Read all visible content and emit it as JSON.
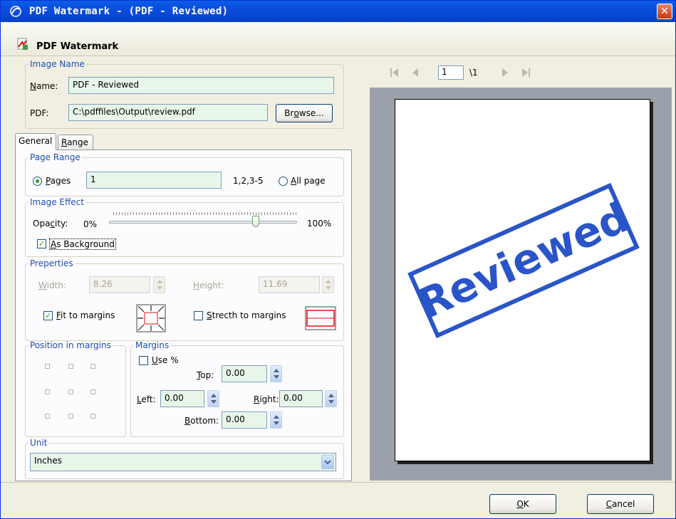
{
  "window": {
    "title": "PDF Watermark - (PDF - Reviewed)",
    "close_glyph": "✕"
  },
  "header": {
    "title": "PDF Watermark"
  },
  "image_name": {
    "legend": "Image Name",
    "name_label_u": "N",
    "name_label_rest": "ame:",
    "name_value": "PDF - Reviewed",
    "pdf_label": "PDF:",
    "pdf_value": "C:\\pdffiles\\Output\\review.pdf",
    "browse_pre": "Br",
    "browse_u": "o",
    "browse_post": "wse..."
  },
  "tabs": {
    "general": "General",
    "range_u": "R",
    "range_rest": "ange"
  },
  "page_range": {
    "legend": "Page Range",
    "pages_u": "P",
    "pages_rest": "ages",
    "pages_value": "1",
    "hint": "1,2,3-5",
    "all_u": "A",
    "all_rest": "ll page",
    "selected": "pages"
  },
  "image_effect": {
    "legend": "Image Effect",
    "opacity_pre": "Opa",
    "opacity_u": "c",
    "opacity_post": "ity:",
    "min_label": "0%",
    "max_label": "100%",
    "opacity_fraction": 0.78,
    "as_background_u": "A",
    "as_background_rest": "s Background",
    "as_background_checked": true
  },
  "properties": {
    "legend": "Preperties",
    "width_u": "W",
    "width_rest": "idth:",
    "width_value": "8.26",
    "height_u": "H",
    "height_rest": "eight:",
    "height_value": "11.69",
    "fit_u": "F",
    "fit_rest": "it to margins",
    "fit_checked": true,
    "stretch_u": "S",
    "stretch_rest": "trecth to margins",
    "stretch_checked": false
  },
  "position": {
    "legend": "Position in margins"
  },
  "margins": {
    "legend": "Margins",
    "use_pct_u": "U",
    "use_pct_rest": "se %",
    "top_u": "T",
    "top_rest": "op:",
    "top_value": "0.00",
    "left_u": "L",
    "left_rest": "eft:",
    "left_value": "0.00",
    "right_u": "R",
    "right_rest": "ight:",
    "right_value": "0.00",
    "bottom_u": "B",
    "bottom_rest": "ottom:",
    "bottom_value": "0.00"
  },
  "unit": {
    "legend": "Unit",
    "value": "Inches"
  },
  "preview": {
    "page_value": "1",
    "page_total": "\\1",
    "watermark_text": "Reviewed",
    "watermark_color": "#2a55c8"
  },
  "footer": {
    "ok_u": "O",
    "ok_rest": "K",
    "cancel_u": "C",
    "cancel_rest": "ancel"
  },
  "icons": {
    "app": "watermark-app-icon",
    "pdf": "pdf-file-icon",
    "first": "first-page-icon",
    "prev": "previous-page-icon",
    "next": "next-page-icon",
    "last": "last-page-icon"
  }
}
